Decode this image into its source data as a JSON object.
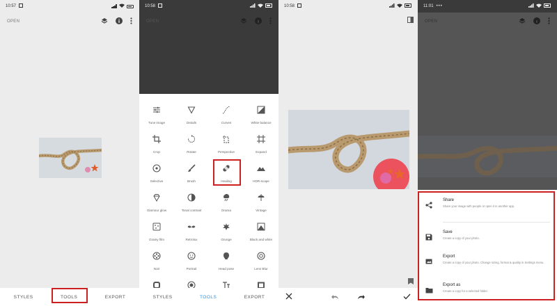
{
  "panels": [
    {
      "status_time": "10:57",
      "open_label": "OPEN",
      "nav": {
        "styles": "STYLES",
        "tools": "TOOLS",
        "export": "EXPORT",
        "active": "none"
      }
    },
    {
      "status_time": "10:58",
      "open_label": "OPEN",
      "nav": {
        "styles": "STYLES",
        "tools": "TOOLS",
        "export": "EXPORT",
        "active": "tools"
      },
      "tools": [
        {
          "label": "Tune image",
          "icon": "tune-icon"
        },
        {
          "label": "Details",
          "icon": "details-icon"
        },
        {
          "label": "Curves",
          "icon": "curves-icon"
        },
        {
          "label": "White balance",
          "icon": "white-balance-icon"
        },
        {
          "label": "Crop",
          "icon": "crop-icon"
        },
        {
          "label": "Rotate",
          "icon": "rotate-icon"
        },
        {
          "label": "Perspective",
          "icon": "perspective-icon"
        },
        {
          "label": "Expand",
          "icon": "expand-icon"
        },
        {
          "label": "Selective",
          "icon": "selective-icon"
        },
        {
          "label": "Brush",
          "icon": "brush-icon"
        },
        {
          "label": "Healing",
          "icon": "healing-icon"
        },
        {
          "label": "HDR-scape",
          "icon": "hdr-icon"
        },
        {
          "label": "Glamour glow",
          "icon": "glamour-glow-icon"
        },
        {
          "label": "Tonal contrast",
          "icon": "tonal-contrast-icon"
        },
        {
          "label": "Drama",
          "icon": "drama-icon"
        },
        {
          "label": "Vintage",
          "icon": "vintage-icon"
        },
        {
          "label": "Grainy film",
          "icon": "grainy-film-icon"
        },
        {
          "label": "Retrolux",
          "icon": "retrolux-icon"
        },
        {
          "label": "Grunge",
          "icon": "grunge-icon"
        },
        {
          "label": "Black and white",
          "icon": "black-white-icon"
        },
        {
          "label": "Noir",
          "icon": "noir-icon"
        },
        {
          "label": "Portrait",
          "icon": "portrait-icon"
        },
        {
          "label": "Head pose",
          "icon": "head-pose-icon"
        },
        {
          "label": "Lens Blur",
          "icon": "lens-blur-icon"
        },
        {
          "label": "",
          "icon": "frames-icon"
        },
        {
          "label": "",
          "icon": "double-exposure-icon"
        },
        {
          "label": "",
          "icon": "text-icon"
        },
        {
          "label": "",
          "icon": "frame-icon"
        }
      ]
    },
    {
      "status_time": "10:58"
    },
    {
      "status_time": "11:01",
      "open_label": "OPEN",
      "sheet": [
        {
          "title": "Share",
          "desc": "Share your image with people or open it in another app.",
          "icon": "share-icon"
        },
        {
          "title": "Save",
          "desc": "Create a copy of your photo.",
          "icon": "save-icon"
        },
        {
          "title": "Export",
          "desc": "Create a copy of your photo. Change sizing, format & quality in Settings menu.",
          "icon": "export-icon"
        },
        {
          "title": "Export as",
          "desc": "Create a copy for a selected folder.",
          "icon": "folder-icon"
        }
      ]
    }
  ],
  "colors": {
    "accent": "#2196f3",
    "highlight": "#cc1f1f",
    "dark": "#3a3a3a"
  }
}
